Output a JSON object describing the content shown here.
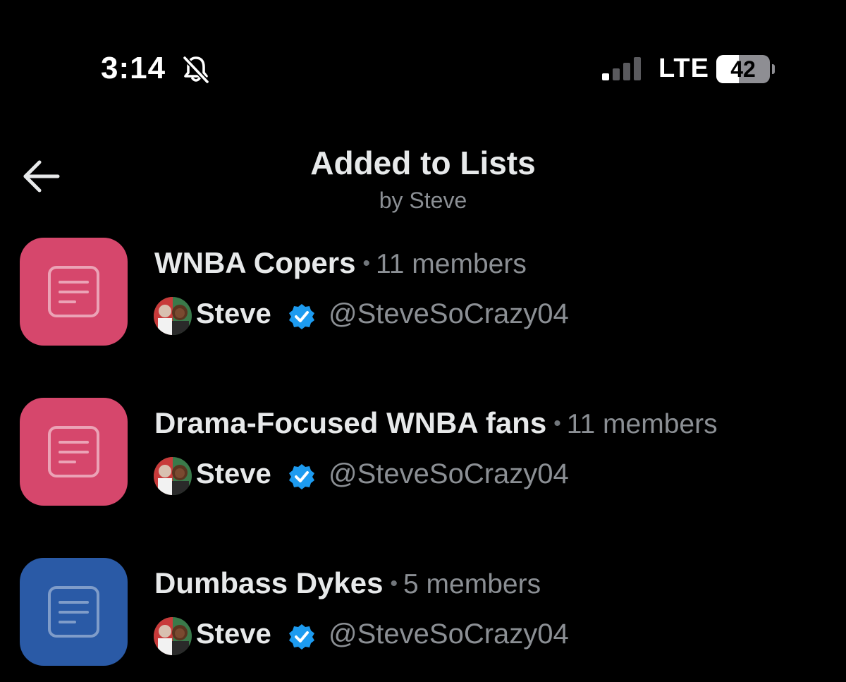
{
  "status_bar": {
    "time": "3:14",
    "network": "LTE",
    "battery": "42",
    "battery_level": 0.42,
    "silent_icon": "bell-slash-icon",
    "signal_icon": "cellular-signal-icon"
  },
  "header": {
    "title": "Added to Lists",
    "subtitle": "by Steve",
    "back_icon": "arrow-left-icon"
  },
  "lists": [
    {
      "name": "WNBA Copers",
      "separator": "•",
      "members": "11 members",
      "owner_name": "Steve",
      "owner_handle": "@SteveSoCrazy04",
      "color": "#d6476c"
    },
    {
      "name": "Drama-Focused WNBA fans",
      "separator": "•",
      "members": "11 members",
      "owner_name": "Steve",
      "owner_handle": "@SteveSoCrazy04",
      "color": "#d6476c"
    },
    {
      "name": "Dumbass Dykes",
      "separator": "•",
      "members": "5 members",
      "owner_name": "Steve",
      "owner_handle": "@SteveSoCrazy04",
      "color": "#2a5aa6"
    }
  ],
  "colors": {
    "background": "#000000",
    "text_primary": "#e7e9ea",
    "text_secondary": "#8b8f94",
    "verified": "#1d9bf0"
  }
}
